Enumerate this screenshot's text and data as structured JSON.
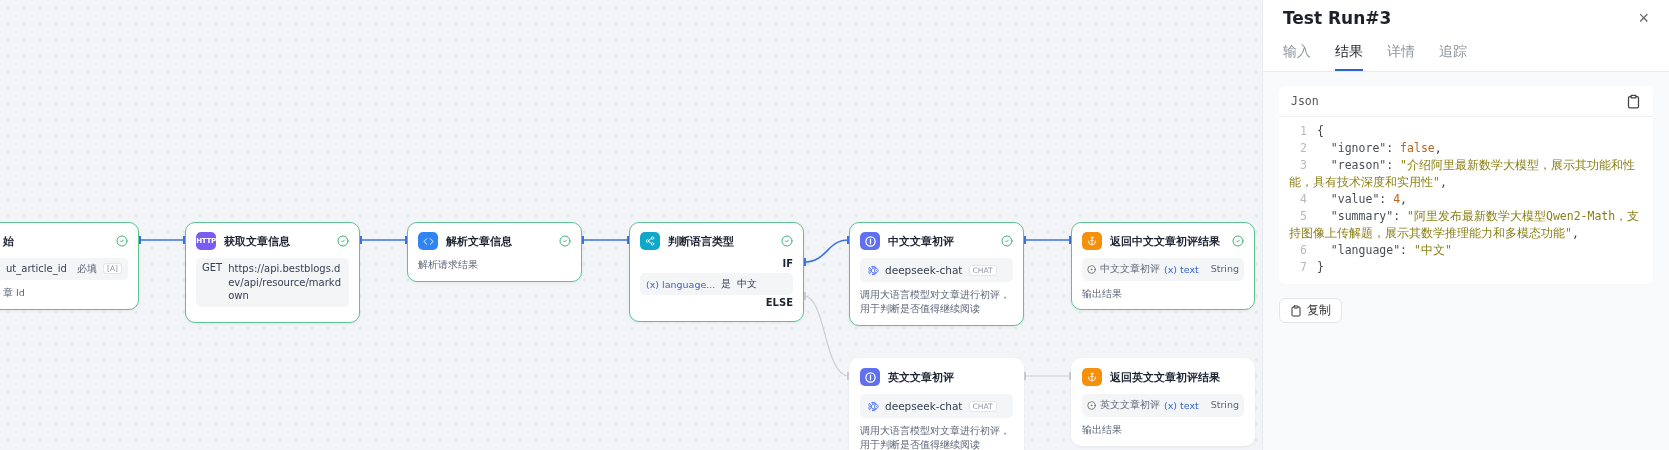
{
  "canvas": {
    "nodes": [
      {
        "kind": "start",
        "title": "始",
        "ran": true,
        "params": [
          {
            "name": "ut_article_id",
            "required": "必填",
            "type": "[A]"
          }
        ],
        "description": "章 Id"
      },
      {
        "kind": "http",
        "icon_text": "HTTP",
        "title": "获取文章信息",
        "ran": true,
        "method": "GET",
        "url": "https://api.bestblogs.dev/api/resource/markdown"
      },
      {
        "kind": "code",
        "title": "解析文章信息",
        "ran": true,
        "description": "解析请求结果"
      },
      {
        "kind": "condition",
        "title": "判断语言类型",
        "ran": true,
        "if_label": "IF",
        "condition": {
          "variable": "(x) language...",
          "operator": "是",
          "value": "中文"
        },
        "else_label": "ELSE"
      },
      {
        "kind": "llm",
        "title": "中文文章初评",
        "ran": true,
        "model": "deepseek-chat",
        "tag": "CHAT",
        "description": "调用大语言模型对文章进行初评，用于判断是否值得继续阅读"
      },
      {
        "kind": "end",
        "title": "返回中文文章初评结果",
        "ran": true,
        "output": {
          "source": "中文文章初评",
          "variable": "(x) text",
          "type": "String"
        },
        "description": "输出结果"
      },
      {
        "kind": "llm",
        "title": "英文文章初评",
        "ran": false,
        "model": "deepseek-chat",
        "tag": "CHAT",
        "description": "调用大语言模型对文章进行初评，用于判断是否值得继续阅读"
      },
      {
        "kind": "end",
        "title": "返回英文文章初评结果",
        "ran": false,
        "output": {
          "source": "英文文章初评",
          "variable": "(x) text",
          "type": "String"
        },
        "description": "输出结果"
      }
    ],
    "edges": [
      {
        "active": true
      },
      {
        "active": true
      },
      {
        "active": true
      },
      {
        "active": true
      },
      {
        "active": true
      },
      {
        "active": false
      },
      {
        "active": false
      }
    ]
  },
  "panel": {
    "title": "Test Run#3",
    "close": "×",
    "tabs": [
      {
        "label": "输入",
        "selected": false
      },
      {
        "label": "结果",
        "selected": true
      },
      {
        "label": "详情",
        "selected": false
      },
      {
        "label": "追踪",
        "selected": false
      }
    ],
    "result": {
      "header": "Json",
      "lines": [
        {
          "number": "1",
          "parts": [
            {
              "kind": "punct",
              "text": "{"
            }
          ]
        },
        {
          "number": "2",
          "parts": [
            {
              "kind": "key",
              "text": "  \"ignore\""
            },
            {
              "kind": "punct",
              "text": ": "
            },
            {
              "kind": "literal",
              "text": "false"
            },
            {
              "kind": "punct",
              "text": ","
            }
          ]
        },
        {
          "number": "3",
          "parts": [
            {
              "kind": "key",
              "text": "  \"reason\""
            },
            {
              "kind": "punct",
              "text": ": "
            },
            {
              "kind": "string",
              "text": "\"介绍阿里最新数学大模型，展示其功能和性能，具有技术深度和实用性\""
            },
            {
              "kind": "punct",
              "text": ","
            }
          ]
        },
        {
          "number": "4",
          "parts": [
            {
              "kind": "key",
              "text": "  \"value\""
            },
            {
              "kind": "punct",
              "text": ": "
            },
            {
              "kind": "literal",
              "text": "4"
            },
            {
              "kind": "punct",
              "text": ","
            }
          ]
        },
        {
          "number": "5",
          "parts": [
            {
              "kind": "key",
              "text": "  \"summary\""
            },
            {
              "kind": "punct",
              "text": ": "
            },
            {
              "kind": "string",
              "text": "\"阿里发布最新数学大模型Qwen2-Math，支持图像上传解题，展示其数学推理能力和多模态功能\""
            },
            {
              "kind": "punct",
              "text": ","
            }
          ]
        },
        {
          "number": "6",
          "parts": [
            {
              "kind": "key",
              "text": "  \"language\""
            },
            {
              "kind": "punct",
              "text": ": "
            },
            {
              "kind": "string",
              "text": "\"中文\""
            }
          ]
        },
        {
          "number": "7",
          "parts": [
            {
              "kind": "punct",
              "text": "}"
            }
          ]
        }
      ]
    },
    "copy_button": "复制"
  }
}
